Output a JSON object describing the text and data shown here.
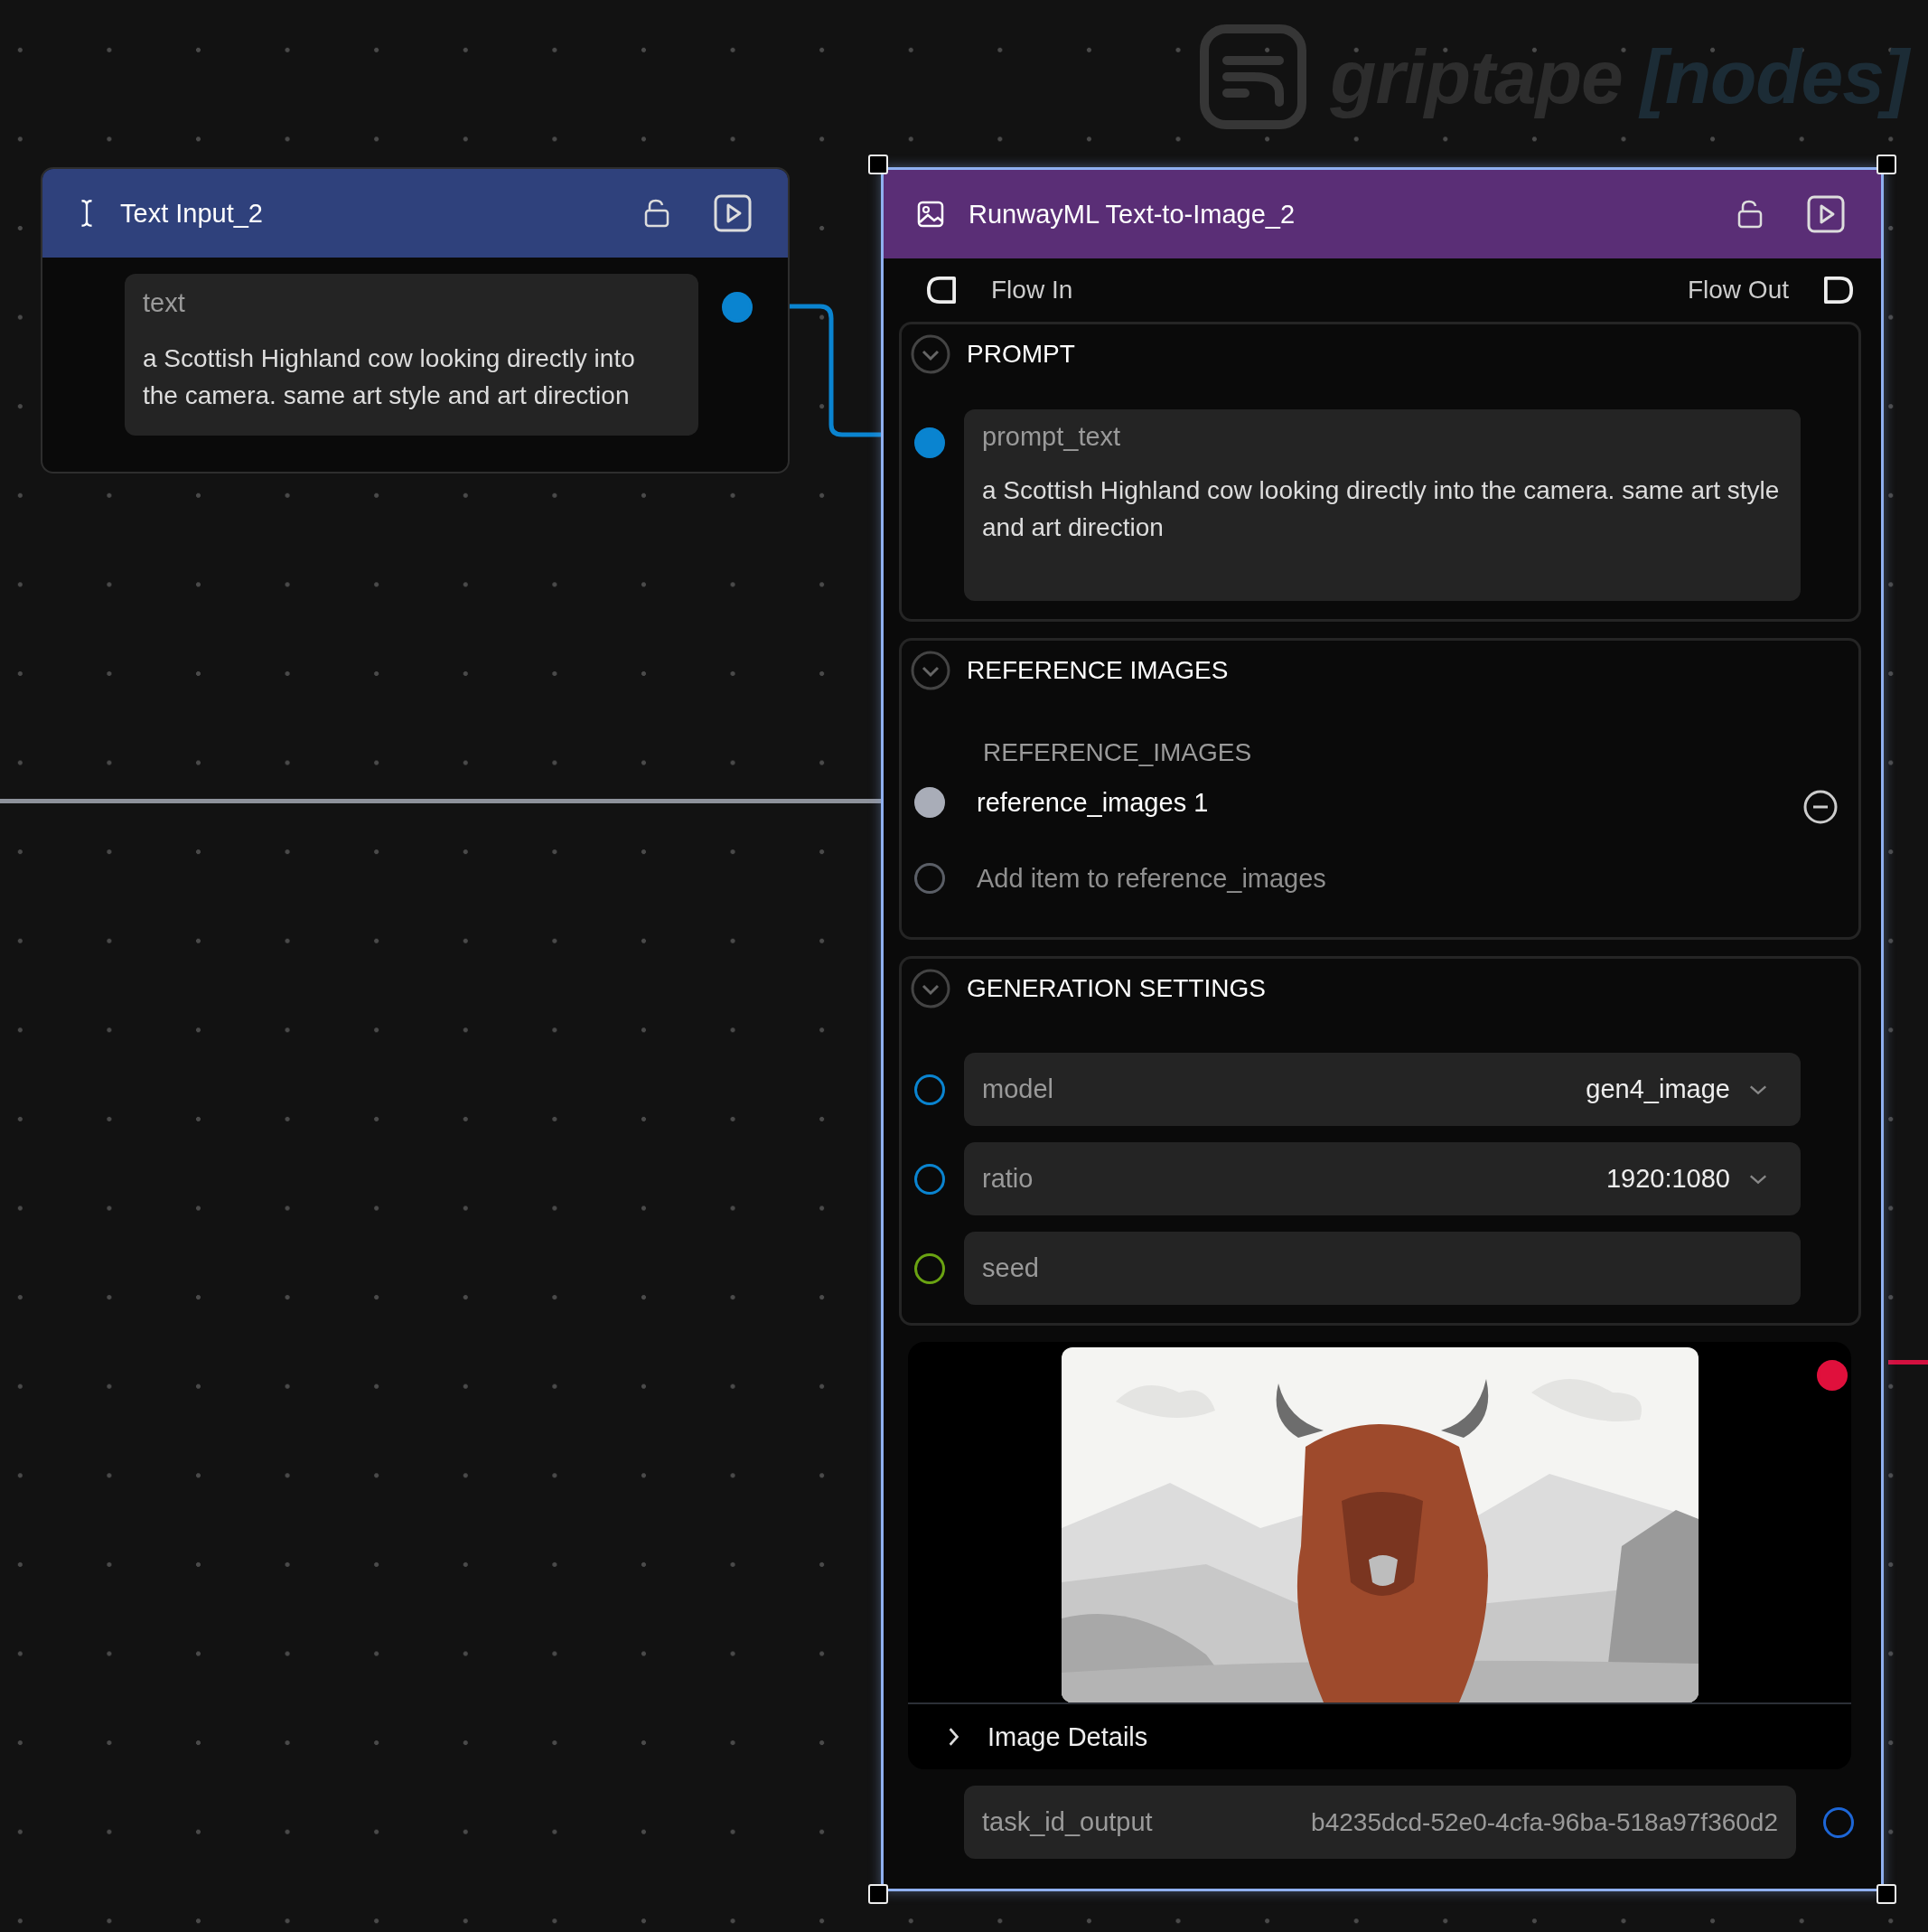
{
  "logo": {
    "name": "griptape",
    "suffix": "[nodes]"
  },
  "edges": [
    {
      "color": "#0a84d0"
    },
    {
      "color": "#8e929b"
    },
    {
      "color": "#d3103f"
    }
  ],
  "text_input_node": {
    "title": "Text Input_2",
    "selected": false,
    "field": {
      "label": "text",
      "value": "a Scottish Highland cow looking directly into the camera. same art style and art direction",
      "port": {
        "color": "#0a84d0",
        "filled": true
      }
    }
  },
  "image_node": {
    "title": "RunwayML Text-to-Image_2",
    "selected": true,
    "flow_in": "Flow In",
    "flow_out": "Flow Out",
    "prompt_section": {
      "title": "PROMPT",
      "expanded": true,
      "param": {
        "label": "prompt_text",
        "value": "a Scottish Highland cow looking directly into the camera. same art style and art direction",
        "port": {
          "color": "#0a84d0",
          "filled": true
        }
      }
    },
    "reference_section": {
      "title": "REFERENCE IMAGES",
      "expanded": true,
      "list_label": "REFERENCE_IMAGES",
      "items": [
        {
          "label": "reference_images 1",
          "port": {
            "color": "#a9adb8",
            "filled": true
          }
        }
      ],
      "add_label": "Add item to reference_images",
      "add_port": {
        "color": "#5a5e66",
        "filled": false
      }
    },
    "generation_section": {
      "title": "GENERATION SETTINGS",
      "expanded": true,
      "params": [
        {
          "kind": "dropdown",
          "label": "model",
          "value": "gen4_image",
          "port": {
            "color": "#0a84d0",
            "filled": false
          }
        },
        {
          "kind": "dropdown",
          "label": "ratio",
          "value": "1920:1080",
          "port": {
            "color": "#0a84d0",
            "filled": false
          }
        },
        {
          "kind": "text",
          "label": "seed",
          "port": {
            "color": "#6aa312",
            "filled": false
          }
        }
      ]
    },
    "output": {
      "port": {
        "color": "#e0103c",
        "filled": true
      },
      "details_label": "Image Details",
      "details_expanded": false
    },
    "task_id": {
      "label": "task_id_output",
      "value": "b4235dcd-52e0-4cfa-96ba-518a97f360d2",
      "port": {
        "color": "#1d66d6",
        "filled": false
      }
    }
  }
}
